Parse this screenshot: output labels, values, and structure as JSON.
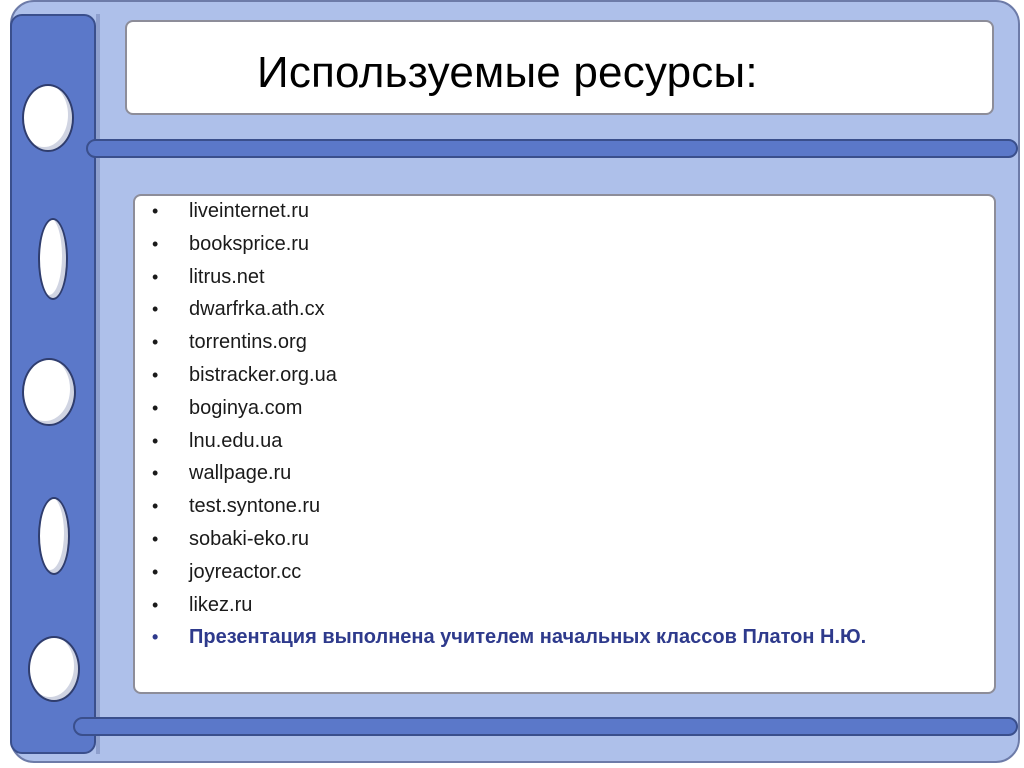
{
  "slide": {
    "title": "Используемые ресурсы:",
    "bullet_char": "•",
    "resources": [
      "liveinternet.ru",
      "booksprice.ru",
      "litrus.net",
      "dwarfrka.ath.cx",
      "torrentins.org",
      "bistracker.org.ua",
      "boginya.com",
      "lnu.edu.ua",
      "wallpage.ru",
      "test.syntone.ru",
      "sobaki-eko.ru",
      "joyreactor.cc",
      "likez.ru"
    ],
    "author_note": "Презентация выполнена учителем начальных классов Платон Н.Ю."
  },
  "colors": {
    "frame": "#aec0ea",
    "binder": "#5b78c9",
    "note_text": "#2e3a8c"
  }
}
